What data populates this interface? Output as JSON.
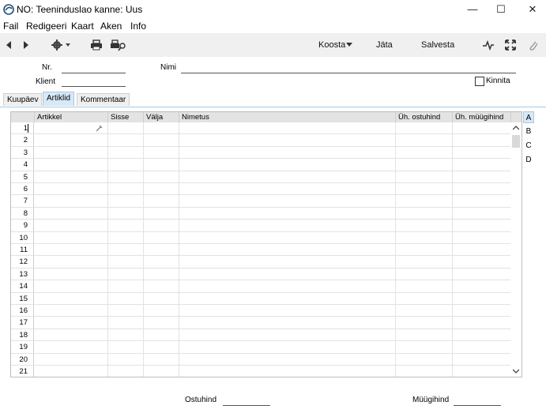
{
  "window": {
    "title": "NO: Teeninduslao kanne: Uus"
  },
  "menu": [
    "Fail",
    "Redigeeri",
    "Kaart",
    "Aken",
    "Info"
  ],
  "toolbar": {
    "koosta": "Koosta",
    "jata": "Jäta",
    "salvesta": "Salvesta"
  },
  "form": {
    "nr_label": "Nr.",
    "nimi_label": "Nimi",
    "klient_label": "Klient",
    "kinnita_label": "Kinnita"
  },
  "tabs": [
    "Kuupäev",
    "Artiklid",
    "Kommentaar"
  ],
  "grid": {
    "columns": [
      "Artikkel",
      "Sisse",
      "Välja",
      "Nimetus",
      "Üh. ostuhind",
      "Üh. müügihind"
    ],
    "rows": [
      "1",
      "2",
      "3",
      "4",
      "5",
      "6",
      "7",
      "8",
      "9",
      "10",
      "11",
      "12",
      "13",
      "14",
      "15",
      "16",
      "17",
      "18",
      "19",
      "20",
      "21"
    ]
  },
  "side_tabs": [
    "A",
    "B",
    "C",
    "D"
  ],
  "footer": {
    "ostuhind_label": "Ostuhind",
    "muugihind_label": "Müügihind"
  }
}
